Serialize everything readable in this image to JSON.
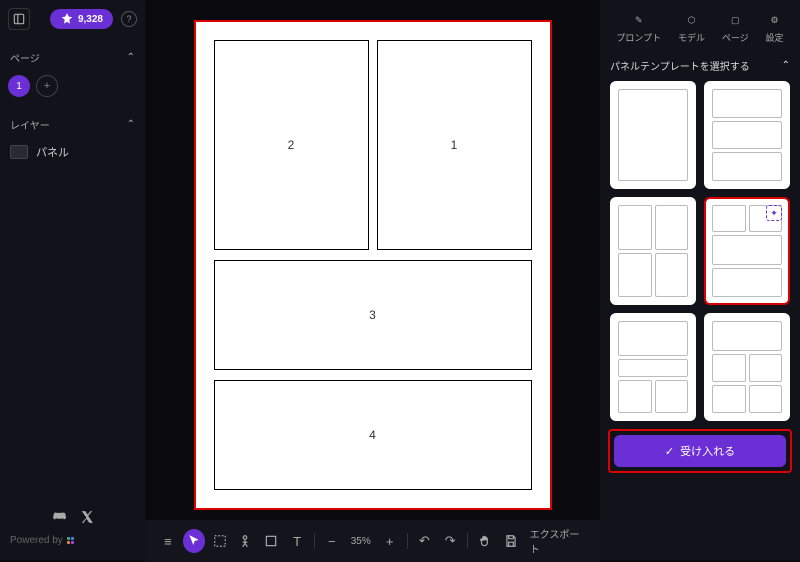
{
  "credits": "9,328",
  "sidebar": {
    "pages_label": "ページ",
    "page_number": "1",
    "layers_label": "レイヤー",
    "layer_item": "パネル",
    "powered_by": "Powered by"
  },
  "canvas": {
    "panels": [
      "2",
      "1",
      "3",
      "4"
    ]
  },
  "toolbar": {
    "zoom": "35%",
    "export": "エクスポート"
  },
  "tabs": {
    "prompt": "プロンプト",
    "model": "モデル",
    "page": "ページ",
    "settings": "設定"
  },
  "templates": {
    "header": "パネルテンプレートを選択する",
    "accept": "受け入れる"
  }
}
